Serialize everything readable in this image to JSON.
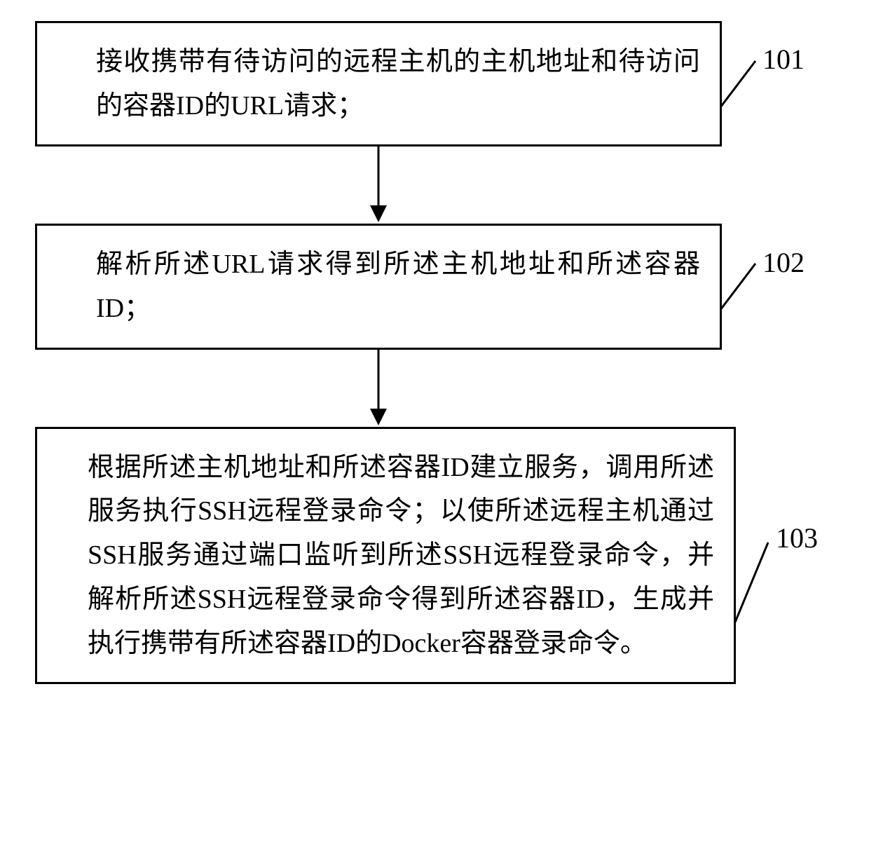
{
  "flowchart": {
    "steps": [
      {
        "label": "101",
        "text": "接收携带有待访问的远程主机的主机地址和待访问的容器ID的URL请求；"
      },
      {
        "label": "102",
        "text": "解析所述URL请求得到所述主机地址和所述容器ID；"
      },
      {
        "label": "103",
        "text": "根据所述主机地址和所述容器ID建立服务，调用所述服务执行SSH远程登录命令；以使所述远程主机通过SSH服务通过端口监听到所述SSH远程登录命令，并解析所述SSH远程登录命令得到所述容器ID，生成并执行携带有所述容器ID的Docker容器登录命令。"
      }
    ]
  }
}
